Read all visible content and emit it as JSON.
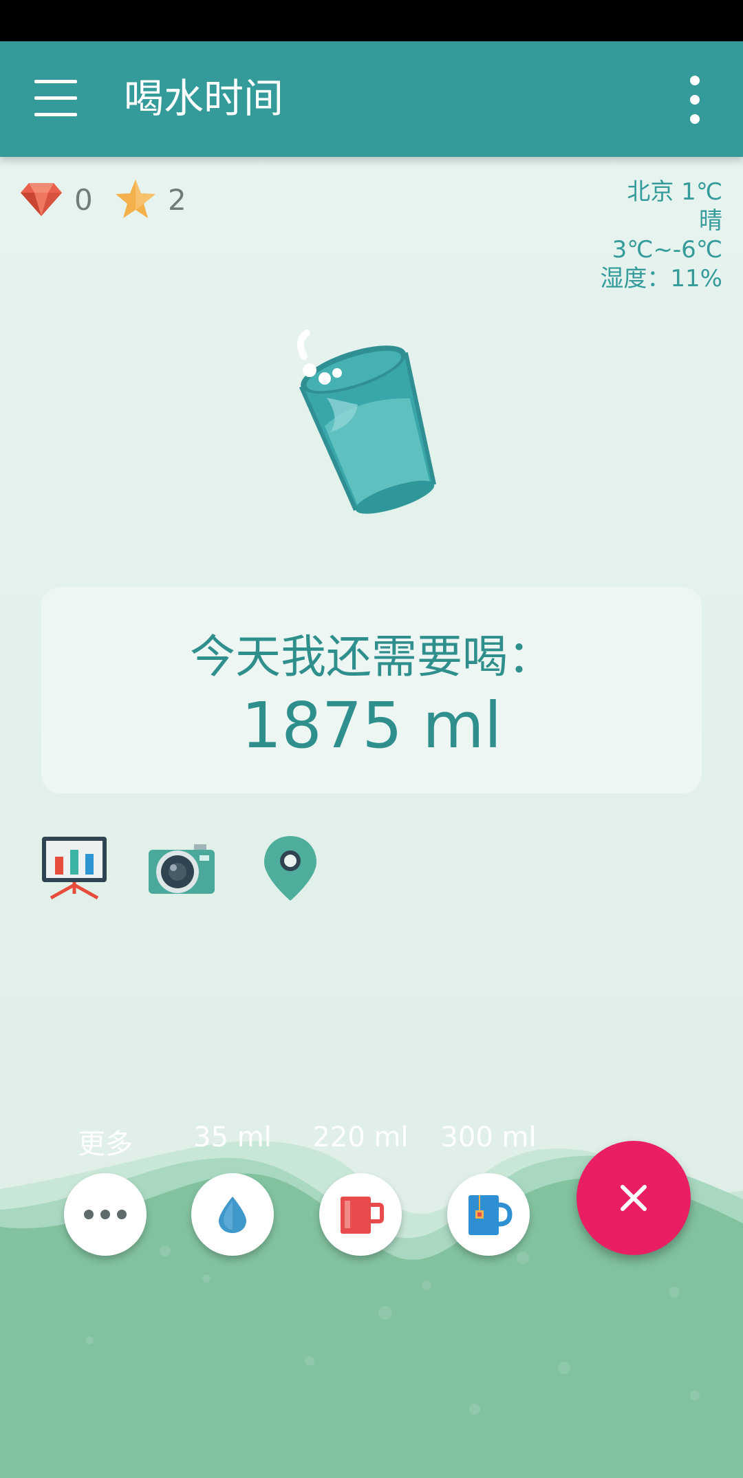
{
  "app": {
    "title": "喝水时间"
  },
  "stats": {
    "gems": "0",
    "stars": "2"
  },
  "weather": {
    "city_temp": "北京 1℃",
    "condition": "晴",
    "range": "3℃~-6℃",
    "humidity": "湿度：11%"
  },
  "card": {
    "label": "今天我还需要喝：",
    "amount": "1875 ml"
  },
  "tools": [
    "chart-icon",
    "camera-icon",
    "location-pin-icon"
  ],
  "quick_add": [
    {
      "label": "更多",
      "icon": "more-dots-icon"
    },
    {
      "label": "35 ml",
      "icon": "water-drop-icon"
    },
    {
      "label": "220 ml",
      "icon": "red-mug-icon"
    },
    {
      "label": "300 ml",
      "icon": "tea-mug-icon"
    }
  ],
  "fab": {
    "icon": "close-icon",
    "color": "#e91e63"
  },
  "colors": {
    "appbar": "#349b9a",
    "accent": "#2f8f8d",
    "wave": "#7fc39b"
  }
}
